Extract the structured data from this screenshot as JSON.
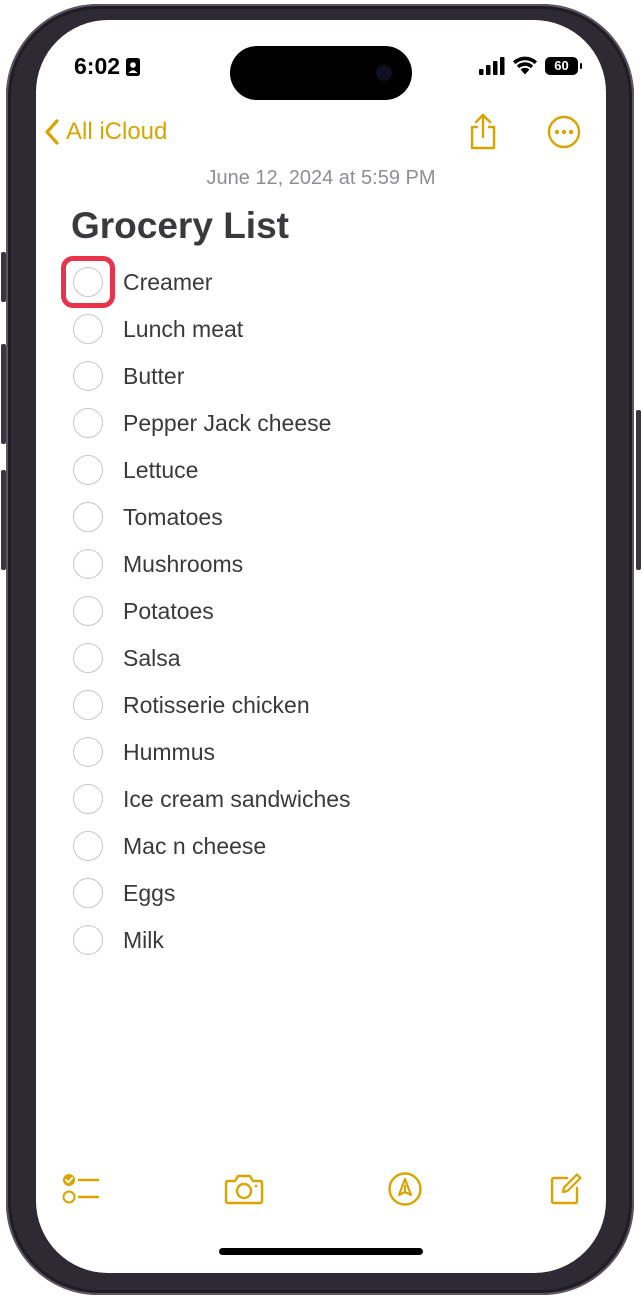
{
  "status_bar": {
    "time": "6:02",
    "battery_level": "60"
  },
  "nav": {
    "back_label": "All iCloud",
    "back_icon": "chevron-left-icon",
    "share_icon": "share-icon",
    "more_icon": "ellipsis-circle-icon"
  },
  "note": {
    "date": "June 12, 2024 at 5:59 PM",
    "title": "Grocery List",
    "items": [
      "Creamer",
      "Lunch meat",
      "Butter",
      "Pepper Jack cheese",
      "Lettuce",
      "Tomatoes",
      "Mushrooms",
      "Potatoes",
      "Salsa",
      "Rotisserie chicken",
      "Hummus",
      "Ice cream sandwiches",
      "Mac n cheese",
      "Eggs",
      "Milk"
    ]
  },
  "toolbar": {
    "checklist_icon": "checklist-icon",
    "camera_icon": "camera-icon",
    "markup_icon": "markup-pen-icon",
    "compose_icon": "compose-icon"
  },
  "colors": {
    "accent": "#d9a400",
    "highlight": "#e8334a",
    "text": "#3a3a3c",
    "secondary_text": "#8e8e93"
  }
}
